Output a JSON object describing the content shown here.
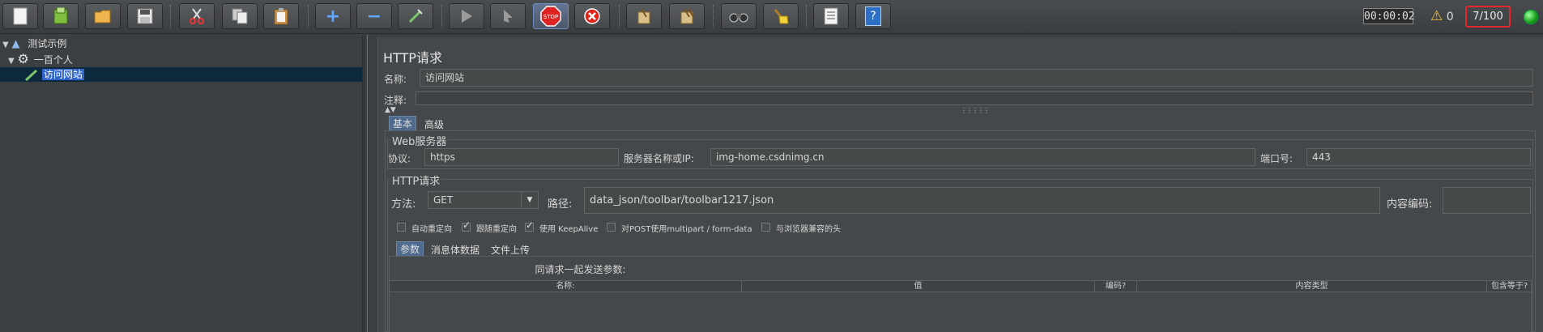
{
  "toolbar": {
    "buttons": [
      {
        "name": "new",
        "icon": "new-document-icon"
      },
      {
        "name": "templates",
        "icon": "templates-icon"
      },
      {
        "name": "open",
        "icon": "open-folder-icon"
      },
      {
        "name": "save",
        "icon": "save-icon"
      },
      {
        "name": "cut",
        "icon": "cut-icon"
      },
      {
        "name": "copy",
        "icon": "copy-icon"
      },
      {
        "name": "paste",
        "icon": "paste-icon"
      },
      {
        "name": "expand",
        "icon": "plus-icon",
        "glyph": "+"
      },
      {
        "name": "collapse",
        "icon": "minus-icon",
        "glyph": "−"
      },
      {
        "name": "toggle",
        "icon": "toggle-wand-icon"
      },
      {
        "name": "start",
        "icon": "play-icon"
      },
      {
        "name": "start-no-pause",
        "icon": "play-no-timers-icon"
      },
      {
        "name": "stop",
        "icon": "stop-icon",
        "glyph": "STOP"
      },
      {
        "name": "shutdown",
        "icon": "shutdown-icon"
      },
      {
        "name": "clear",
        "icon": "clear-broom-icon"
      },
      {
        "name": "clear-all",
        "icon": "clear-all-broom-icon"
      },
      {
        "name": "search",
        "icon": "binoculars-icon"
      },
      {
        "name": "reset-search",
        "icon": "reset-search-icon"
      },
      {
        "name": "function-helper",
        "icon": "function-list-icon"
      },
      {
        "name": "help",
        "icon": "help-icon",
        "glyph": "?"
      }
    ],
    "timer": "00:00:02",
    "warning_count": "0",
    "thread_counter": "7/100",
    "status_color": "#1aa11a"
  },
  "tree": {
    "root": "测试示例",
    "thread_group": "一百个人",
    "sampler": "访问网站"
  },
  "sampler": {
    "title": "HTTP请求",
    "name_label": "名称:",
    "name_value": "访问网站",
    "comment_label": "注释:",
    "comment_value": "",
    "tabs": {
      "basic": "基本",
      "advanced": "高级"
    },
    "web_server": {
      "legend": "Web服务器",
      "protocol_label": "协议:",
      "protocol_value": "https",
      "server_label": "服务器名称或IP:",
      "server_value": "img-home.csdnimg.cn",
      "port_label": "端口号:",
      "port_value": "443"
    },
    "http_request": {
      "legend": "HTTP请求",
      "method_label": "方法:",
      "method_value": "GET",
      "path_label": "路径:",
      "path_value": "data_json/toolbar/toolbar1217.json",
      "encoding_label": "内容编码:",
      "encoding_value": ""
    },
    "checkboxes": [
      {
        "label": "自动重定向",
        "checked": false
      },
      {
        "label": "跟随重定向",
        "checked": true
      },
      {
        "label": "使用 KeepAlive",
        "checked": true
      },
      {
        "label": "对POST使用multipart / form-data",
        "checked": false
      },
      {
        "label": "与浏览器兼容的头",
        "checked": false
      }
    ],
    "param_tabs": {
      "params": "参数",
      "body": "消息体数据",
      "files": "文件上传"
    },
    "params_caption": "同请求一起发送参数:",
    "columns": [
      "名称:",
      "值",
      "编码?",
      "内容类型",
      "包含等于?"
    ]
  },
  "colors": {
    "background": "#3c3f41",
    "tree_selection": "#0d293e",
    "counter_border": "#e4262d",
    "tab_selected": "#4e6a8c"
  }
}
